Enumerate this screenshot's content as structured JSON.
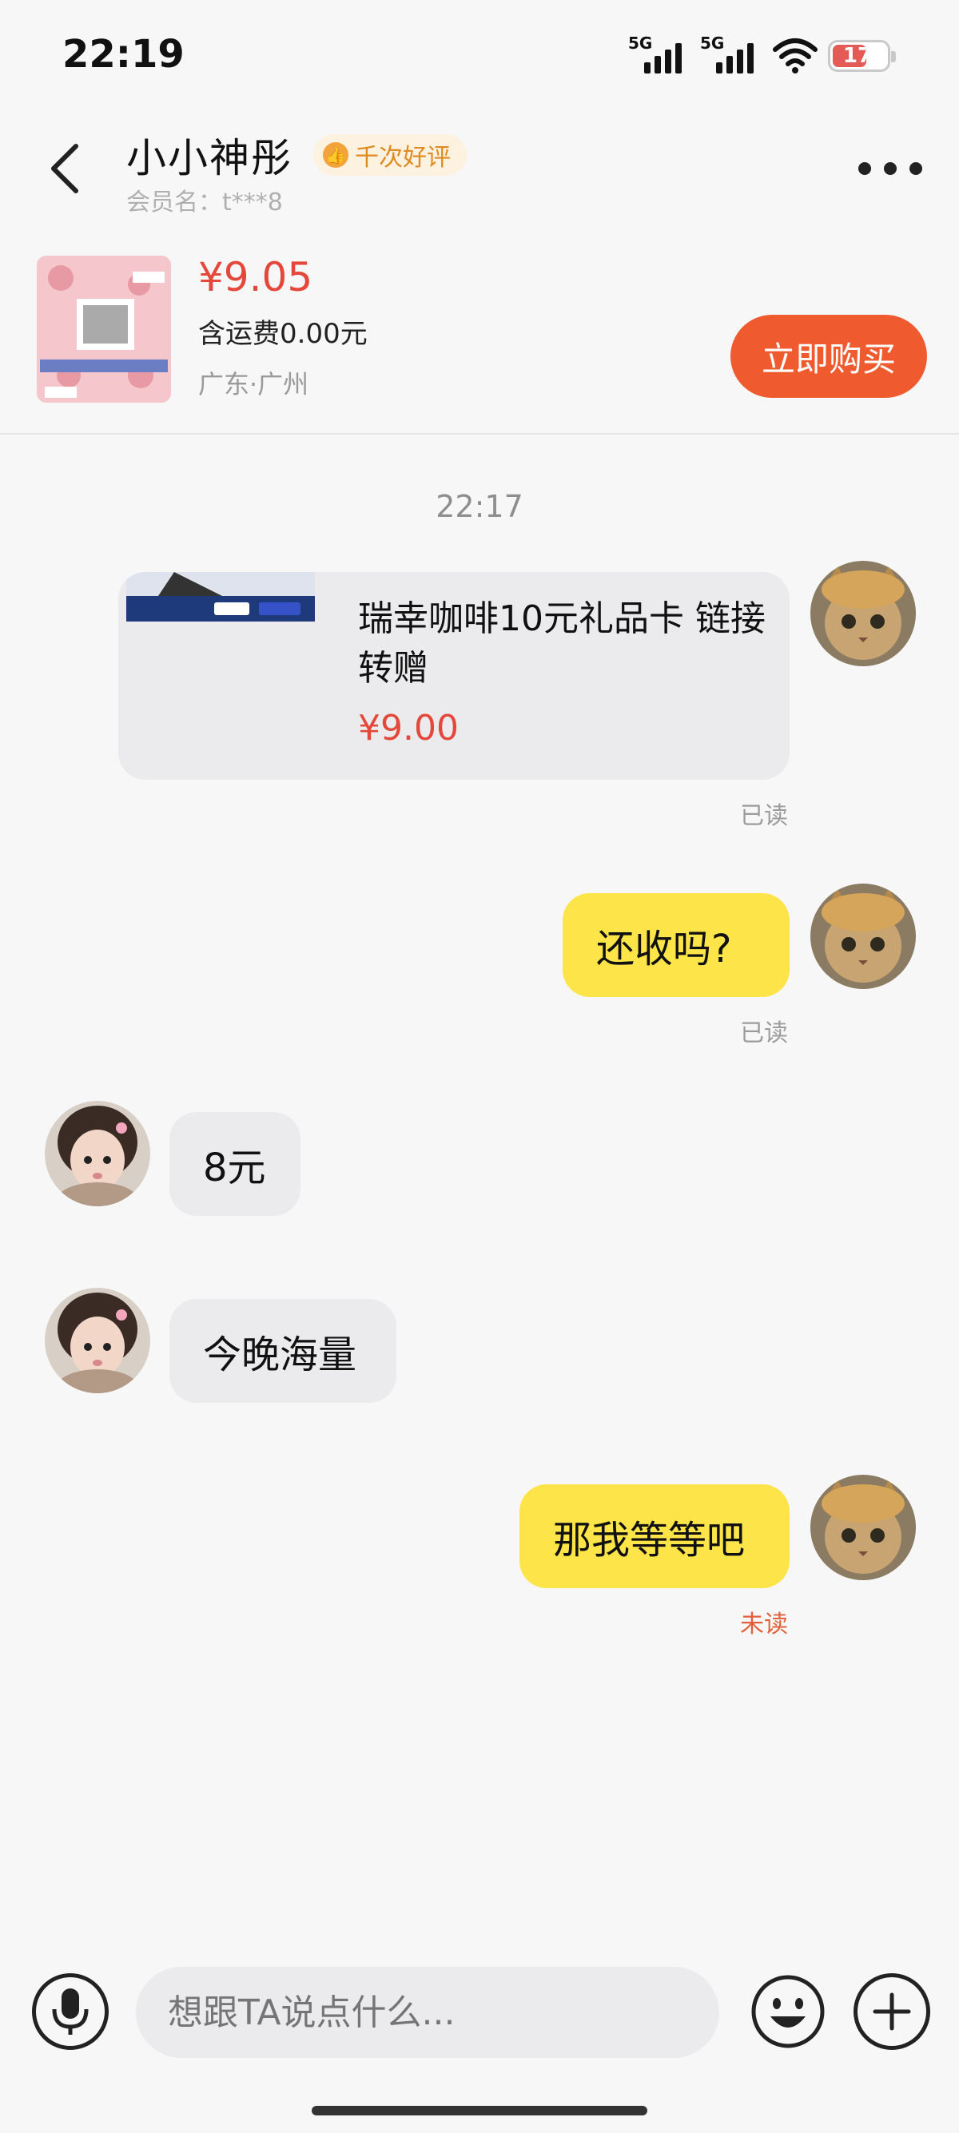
{
  "status_bar": {
    "time": "22:19",
    "signal1": "5G",
    "signal2": "5G",
    "battery": "17",
    "battery_color": "#e35a57"
  },
  "header": {
    "title": "小小神彤",
    "badge": "千次好评",
    "member": "会员名：t***8",
    "back_icon": "chevron-left-icon",
    "more_icon": "more-dots-icon"
  },
  "product": {
    "price": "¥9.05",
    "shipping": "含运费0.00元",
    "location": "广东·广州",
    "buy_label": "立即购买",
    "buy_color": "#ef5b2f"
  },
  "chat": {
    "time_separator": "22:17",
    "item_card": {
      "name": "瑞幸咖啡10元礼品卡 链接转赠",
      "price": "¥9.00",
      "read": "已读"
    },
    "messages": [
      {
        "side": "me",
        "text": "还收吗?",
        "read": "已读"
      },
      {
        "side": "other",
        "text": "8元"
      },
      {
        "side": "other",
        "text": "今晚海量"
      },
      {
        "side": "me",
        "text": "那我等等吧",
        "read": "未读"
      }
    ]
  },
  "input_bar": {
    "placeholder": "想跟TA说点什么...",
    "mic_icon": "microphone-icon",
    "emoji_icon": "emoji-icon",
    "plus_icon": "plus-icon"
  },
  "colors": {
    "my_bubble": "#fde448",
    "other_bubble": "#ebebed",
    "price_red": "#e4483a",
    "unread": "#e2603a"
  }
}
